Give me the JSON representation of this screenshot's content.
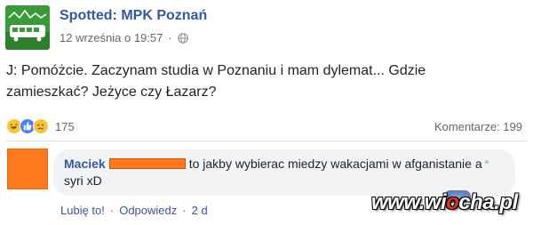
{
  "post": {
    "page_name": "Spotted: MPK Poznań",
    "timestamp": "12 września o 19:57",
    "separator": "·",
    "privacy_icon": "globe-icon",
    "text": "J: Pomóżcie. Zaczynam studia w Poznaniu i mam dylemat... Gdzie zamieszkać? Jeżyce czy Łazarz?",
    "reactions": {
      "icons": [
        "haha-icon",
        "like-icon",
        "sad-icon"
      ],
      "count": "175"
    },
    "comments_label": "Komentarze: 199"
  },
  "comment": {
    "author": "Maciek",
    "text": "to jakby wybierac miedzy wakacjami w afganistanie a syri xD",
    "actions": {
      "like": "Lubię to!",
      "dot1": "·",
      "reply": "Odpowiedz",
      "dot2": "·",
      "age": "2 d"
    }
  },
  "watermark": {
    "text_prefix": "www.wi",
    "text_o": "o",
    "text_suffix": "cha.pl"
  },
  "colors": {
    "link_blue": "#365899",
    "meta_grey": "#616770",
    "comment_bg": "#f2f3f5",
    "redact_orange": "#ff7a1f",
    "avatar_green": "#3a9a3a"
  }
}
